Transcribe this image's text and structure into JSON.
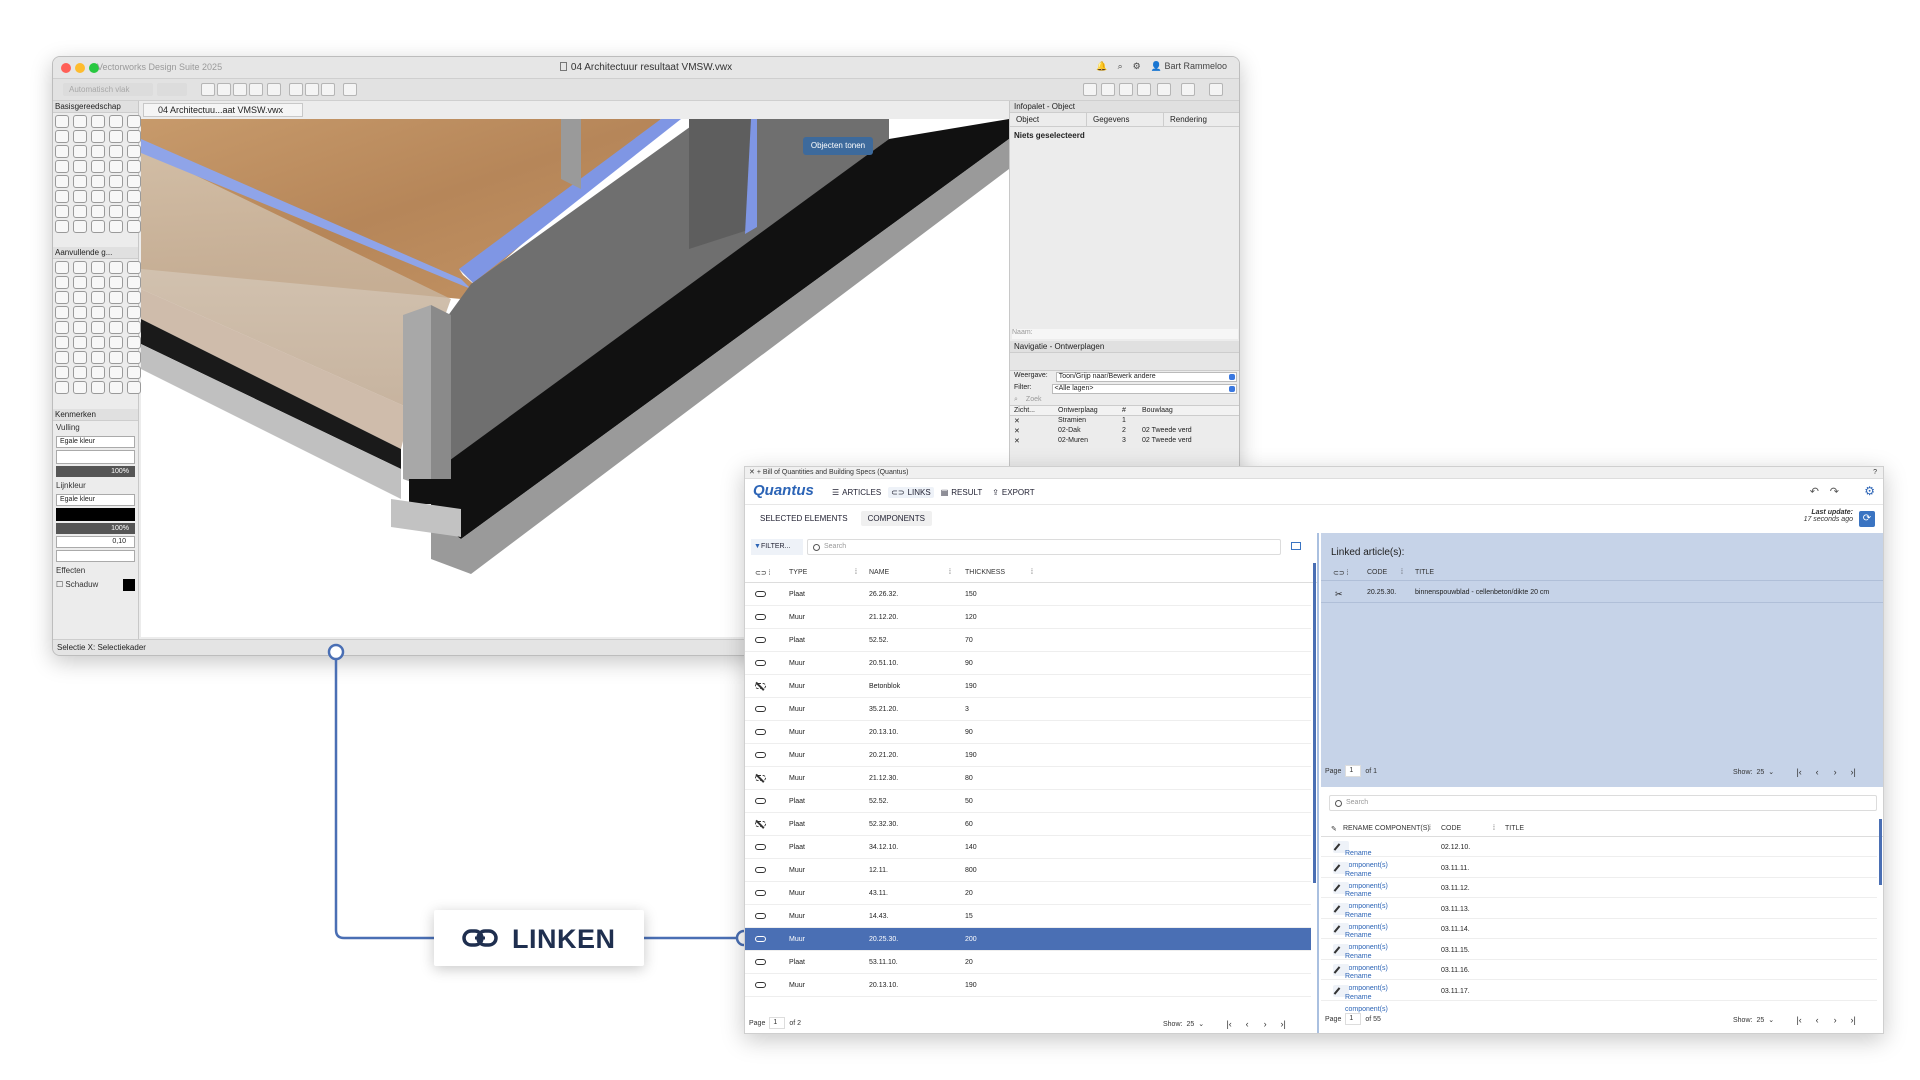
{
  "vectorworks": {
    "app_name": "Vectorworks Design Suite 2025",
    "document_title": "04 Architectuur resultaat VMSW.vwx",
    "user": "Bart Rammeloo",
    "plane_field": "Automatisch vlak",
    "doc_tab": "04 Architectuu...aat VMSW.vwx",
    "palettes": {
      "basic": "Basisgereedschap",
      "extra": "Aanvullende g...",
      "attributes": "Kenmerken"
    },
    "attributes": {
      "fill_label": "Vulling",
      "fill_value": "Egale kleur",
      "fill_opacity": "100%",
      "line_label": "Lijnkleur",
      "line_value": "Egale kleur",
      "line_opacity": "100%",
      "line_thickness": "0,10",
      "effects_label": "Effecten",
      "shadow_label": "Schaduw"
    },
    "status": "Selectie  X: Selectiekader",
    "show_objects_button": "Objecten tonen",
    "info_palette": {
      "title": "Infopalet - Object",
      "tab_object": "Object",
      "tab_data": "Gegevens",
      "tab_render": "Rendering",
      "status": "Niets geselecteerd",
      "name_label": "Naam:"
    },
    "nav_palette": {
      "title": "Navigatie - Ontwerplagen",
      "view_label": "Weergave:",
      "view_value": "Toon/Grijp naar/Bewerk andere",
      "filter_label": "Filter:",
      "filter_value": "<Alle lagen>",
      "search_placeholder": "Zoek",
      "col_visibility": "Zicht...",
      "col_layer": "Ontwerplaag",
      "col_num": "#",
      "col_level": "Bouwlaag",
      "layers": [
        {
          "name": "Stramien",
          "num": "1",
          "level": ""
        },
        {
          "name": "02-Dak",
          "num": "2",
          "level": "02 Tweede verd"
        },
        {
          "name": "02-Muren",
          "num": "3",
          "level": "02 Tweede verd"
        }
      ]
    }
  },
  "quantus": {
    "window_title": "Bill of Quantities and Building Specs (Quantus)",
    "logo": "Quantus",
    "nav": {
      "articles": "ARTICLES",
      "links": "LINKS",
      "result": "RESULT",
      "export": "EXPORT"
    },
    "subtabs": {
      "selected": "SELECTED ELEMENTS",
      "components": "COMPONENTS"
    },
    "last_update_label": "Last update:",
    "last_update_value": "17 seconds ago",
    "left": {
      "filter_label": "FILTER...",
      "search_placeholder": "Search",
      "columns": {
        "type": "TYPE",
        "name": "NAME",
        "thickness": "THICKNESS"
      },
      "rows": [
        {
          "linked": true,
          "type": "Plaat",
          "name": "26.26.32.",
          "thickness": "150"
        },
        {
          "linked": true,
          "type": "Muur",
          "name": "21.12.20.",
          "thickness": "120"
        },
        {
          "linked": true,
          "type": "Plaat",
          "name": "52.52.",
          "thickness": "70"
        },
        {
          "linked": true,
          "type": "Muur",
          "name": "20.51.10.",
          "thickness": "90"
        },
        {
          "linked": false,
          "type": "Muur",
          "name": "Betonblok",
          "thickness": "190"
        },
        {
          "linked": true,
          "type": "Muur",
          "name": "35.21.20.",
          "thickness": "3"
        },
        {
          "linked": true,
          "type": "Muur",
          "name": "20.13.10.",
          "thickness": "90"
        },
        {
          "linked": true,
          "type": "Muur",
          "name": "20.21.20.",
          "thickness": "190"
        },
        {
          "linked": false,
          "type": "Muur",
          "name": "21.12.30.",
          "thickness": "80"
        },
        {
          "linked": true,
          "type": "Plaat",
          "name": "52.52.",
          "thickness": "50"
        },
        {
          "linked": false,
          "type": "Plaat",
          "name": "52.32.30.",
          "thickness": "60"
        },
        {
          "linked": true,
          "type": "Plaat",
          "name": "34.12.10.",
          "thickness": "140"
        },
        {
          "linked": true,
          "type": "Muur",
          "name": "12.11.",
          "thickness": "800"
        },
        {
          "linked": true,
          "type": "Muur",
          "name": "43.11.",
          "thickness": "20"
        },
        {
          "linked": true,
          "type": "Muur",
          "name": "14.43.",
          "thickness": "15"
        },
        {
          "linked": true,
          "type": "Muur",
          "name": "20.25.30.",
          "thickness": "200",
          "selected": true
        },
        {
          "linked": true,
          "type": "Plaat",
          "name": "53.11.10.",
          "thickness": "20"
        },
        {
          "linked": true,
          "type": "Muur",
          "name": "20.13.10.",
          "thickness": "190"
        }
      ],
      "page_label": "Page",
      "page_value": "1",
      "page_of": "of 2",
      "show_label": "Show:",
      "show_value": "25"
    },
    "linked": {
      "title": "Linked article(s):",
      "columns": {
        "code": "CODE",
        "title": "TITLE"
      },
      "rows": [
        {
          "code": "20.25.30.",
          "title": "binnenspouwblad - cellenbeton/dikte 20 cm"
        }
      ],
      "page_label": "Page",
      "page_value": "1",
      "page_of": "of 1",
      "show_label": "Show:",
      "show_value": "25"
    },
    "components": {
      "search_placeholder": "Search",
      "columns": {
        "rename": "RENAME COMPONENT(S)",
        "code": "CODE",
        "title": "TITLE"
      },
      "rows": [
        {
          "action": "Rename component(s)",
          "code": "02.12.10."
        },
        {
          "action": "Rename component(s)",
          "code": "03.11.11."
        },
        {
          "action": "Rename component(s)",
          "code": "03.11.12."
        },
        {
          "action": "Rename component(s)",
          "code": "03.11.13."
        },
        {
          "action": "Rename component(s)",
          "code": "03.11.14."
        },
        {
          "action": "Rename component(s)",
          "code": "03.11.15."
        },
        {
          "action": "Rename component(s)",
          "code": "03.11.16."
        },
        {
          "action": "Rename component(s)",
          "code": "03.11.17."
        }
      ],
      "page_label": "Page",
      "page_value": "1",
      "page_of": "of 55",
      "show_label": "Show:",
      "show_value": "25"
    }
  },
  "callout": {
    "label": "LINKEN",
    "line_color": "#4a6fb4"
  }
}
